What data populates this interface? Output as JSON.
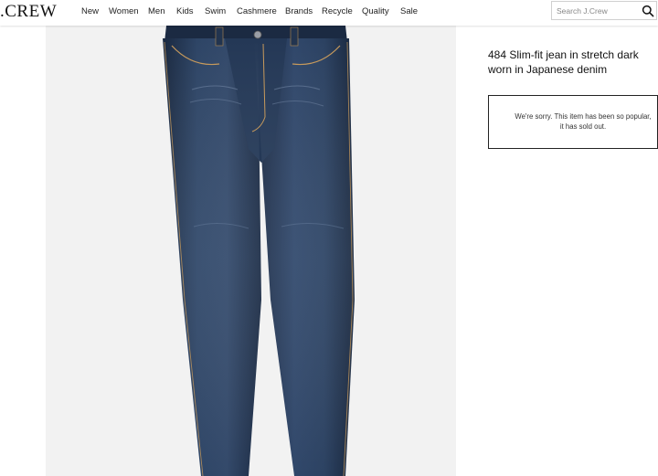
{
  "header": {
    "logo": "J.CREW",
    "nav": [
      "New",
      "Women",
      "Men",
      "Kids",
      "Swim",
      "Cashmere",
      "Brands",
      "Recycle",
      "Quality",
      "Sale"
    ],
    "search": {
      "placeholder": "Search J.Crew",
      "icon": "search-icon"
    }
  },
  "product": {
    "title": "484 Slim-fit jean in stretch dark worn in Japanese denim",
    "image": "slim-fit-jeans-product-image",
    "soldout_message": "We're sorry. This item has been so popular, it has sold out."
  },
  "colors": {
    "denim_dark": "#1c2c46",
    "denim_mid": "#2f4565",
    "image_background": "#f2f2f2",
    "border": "#222222"
  }
}
